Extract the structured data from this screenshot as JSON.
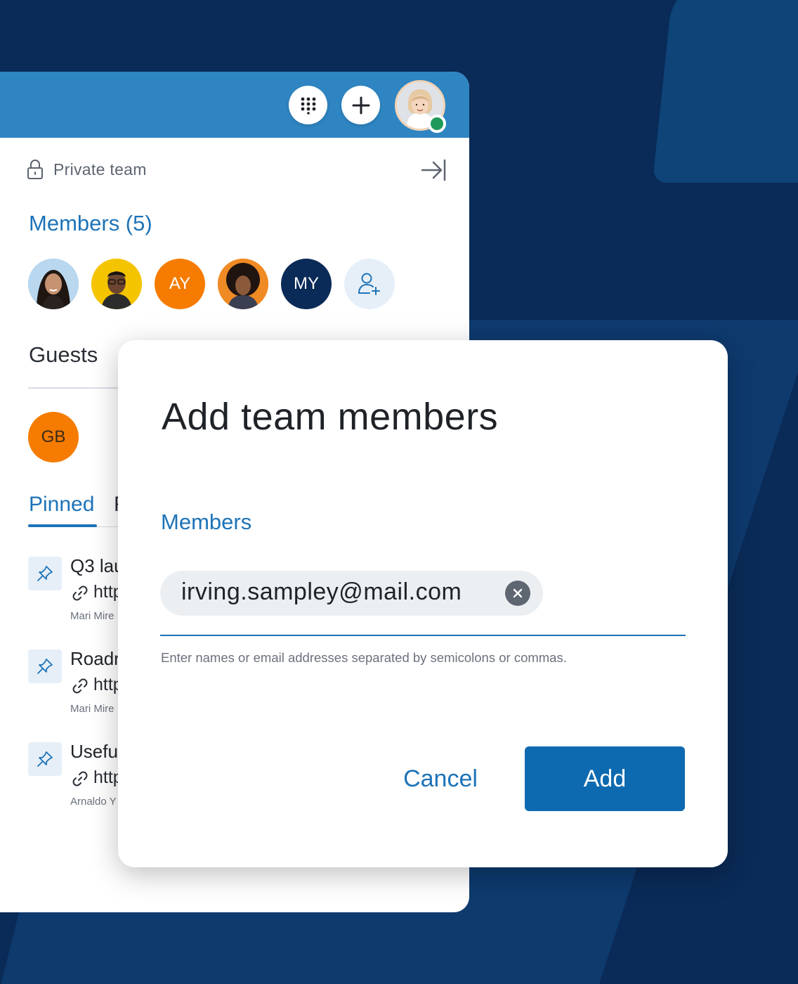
{
  "header": {
    "dialpad_icon": "dialpad-icon",
    "add_icon": "plus-icon",
    "user_avatar_status": "online",
    "status_color": "#1f9a5a"
  },
  "team": {
    "privacy_label": "Private team",
    "members_title": "Members (5)",
    "members": [
      {
        "type": "photo",
        "initials": ""
      },
      {
        "type": "photo",
        "initials": ""
      },
      {
        "type": "initials",
        "initials": "AY",
        "color": "#f57c00"
      },
      {
        "type": "photo",
        "initials": ""
      },
      {
        "type": "initials",
        "initials": "MY",
        "color": "#0a2a57"
      }
    ],
    "guests_title": "Guests",
    "guest_initials": "GB",
    "guest_color": "#f57c00"
  },
  "tabs": {
    "pinned": "Pinned",
    "other": "F"
  },
  "pinned_items": [
    {
      "title": "Q3 lau",
      "link": "http",
      "author": "Mari Mire"
    },
    {
      "title": "Roadr",
      "link": "http",
      "author": "Mari Mire"
    },
    {
      "title": "Usefu",
      "link": "http",
      "author": "Arnaldo Y"
    }
  ],
  "dialog": {
    "title": "Add team members",
    "field_label": "Members",
    "chip_value": "irving.sampley@mail.com",
    "hint": "Enter names or email addresses separated by semicolons or commas.",
    "cancel_label": "Cancel",
    "add_label": "Add"
  },
  "colors": {
    "accent": "#1d73b8",
    "primary_button": "#0e6ab0",
    "header_bar": "#2e85c2",
    "background": "#0a2a57"
  }
}
